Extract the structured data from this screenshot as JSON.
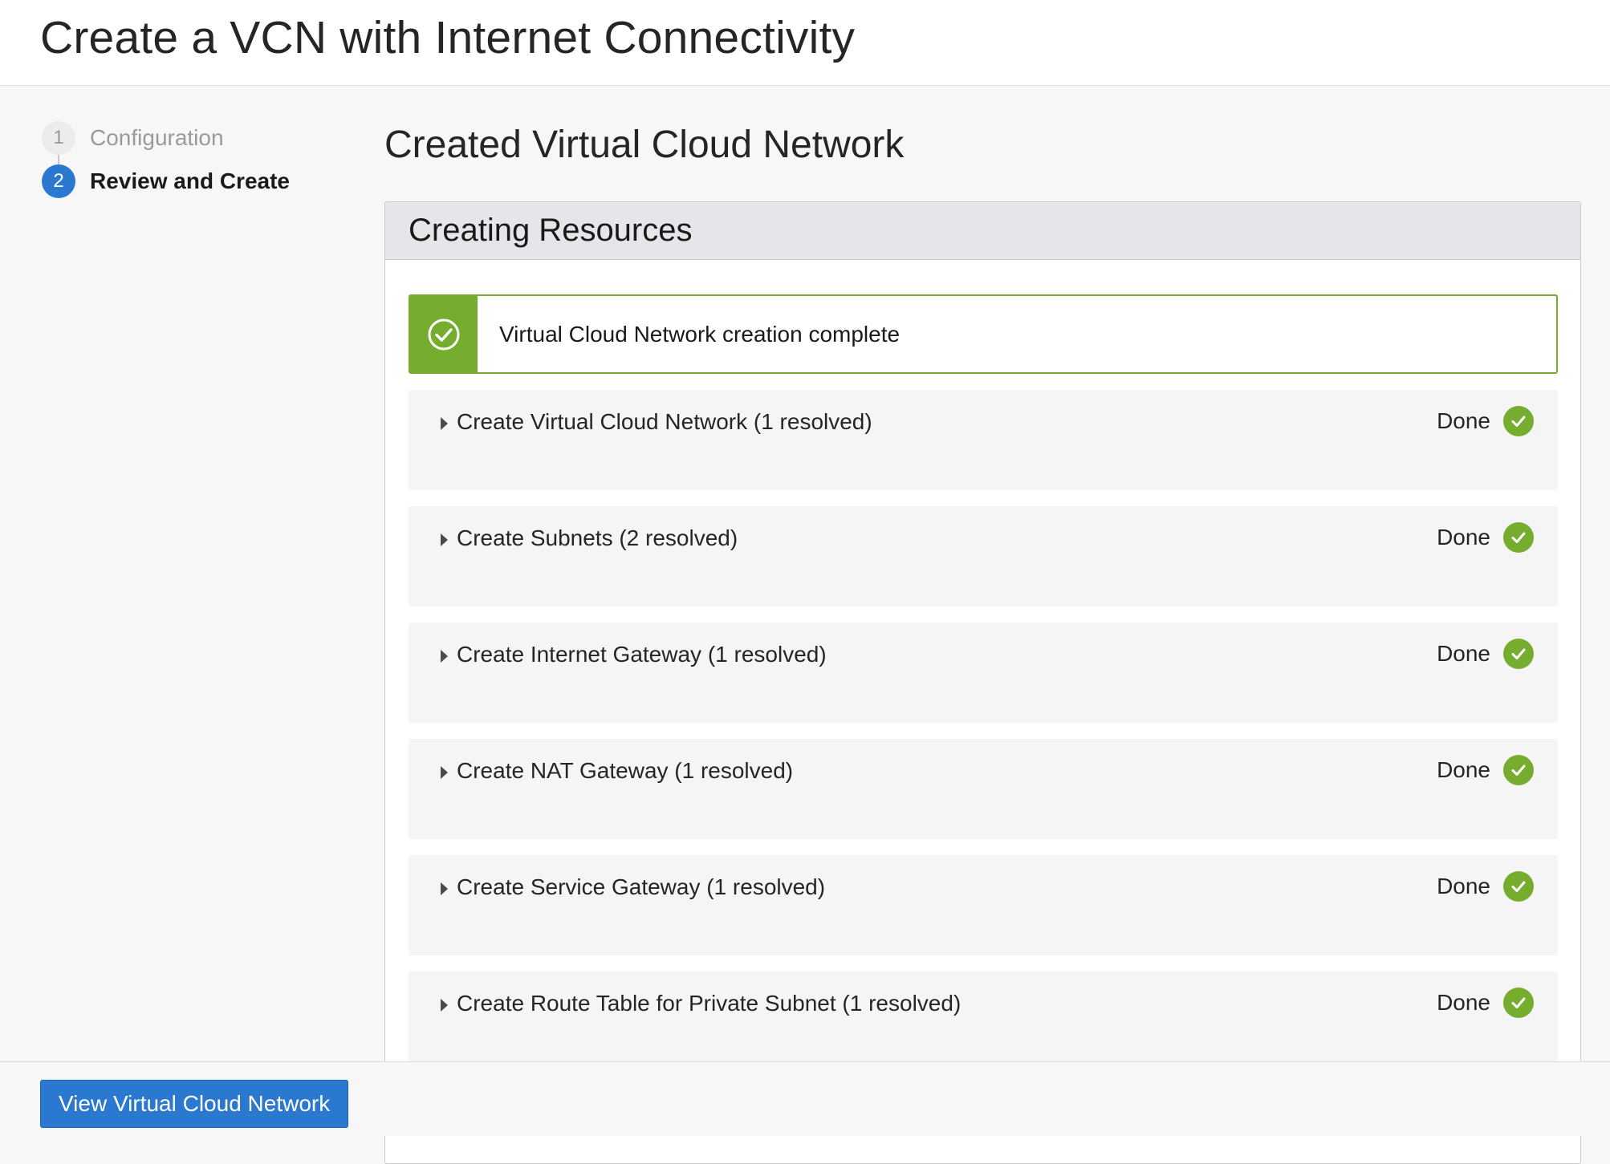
{
  "header": {
    "title": "Create a VCN with Internet Connectivity"
  },
  "stepper": {
    "steps": [
      {
        "number": "1",
        "label": "Configuration",
        "state": "completed"
      },
      {
        "number": "2",
        "label": "Review and Create",
        "state": "active"
      }
    ]
  },
  "main": {
    "title": "Created Virtual Cloud Network",
    "panel": {
      "title": "Creating Resources",
      "banner": {
        "text": "Virtual Cloud Network creation complete",
        "icon": "check-circle-icon"
      },
      "tasks": [
        {
          "label": "Create Virtual Cloud Network (1 resolved)",
          "status": "Done"
        },
        {
          "label": "Create Subnets (2 resolved)",
          "status": "Done"
        },
        {
          "label": "Create Internet Gateway (1 resolved)",
          "status": "Done"
        },
        {
          "label": "Create NAT Gateway (1 resolved)",
          "status": "Done"
        },
        {
          "label": "Create Service Gateway (1 resolved)",
          "status": "Done"
        },
        {
          "label": "Create Route Table for Private Subnet (1 resolved)",
          "status": "Done"
        }
      ]
    }
  },
  "footer": {
    "primary_button_label": "View Virtual Cloud Network"
  },
  "colors": {
    "accent_blue": "#2a78d0",
    "success_green": "#77ad2e"
  }
}
